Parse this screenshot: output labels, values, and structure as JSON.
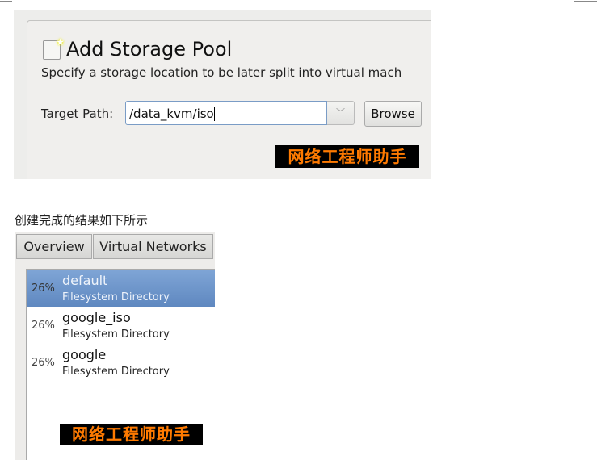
{
  "dialog": {
    "title": "Add Storage Pool",
    "subtitle": "Specify a storage location to be later split into virtual mach",
    "target_path_label": "Target Path:",
    "target_path_value": "/data_kvm/iso",
    "browse_label": "Browse"
  },
  "watermark": "网络工程师助手",
  "caption": "创建完成的结果如下所示",
  "manager": {
    "tabs": [
      {
        "label": "Overview"
      },
      {
        "label": "Virtual Networks"
      }
    ],
    "pools": [
      {
        "usage": "26%",
        "name": "default",
        "type": "Filesystem Directory",
        "selected": true
      },
      {
        "usage": "26%",
        "name": "google_iso",
        "type": "Filesystem Directory",
        "selected": false
      },
      {
        "usage": "26%",
        "name": "google",
        "type": "Filesystem Directory",
        "selected": false
      }
    ]
  },
  "colors": {
    "selection": "#6f97cc",
    "watermark_text": "#ff7a00"
  }
}
